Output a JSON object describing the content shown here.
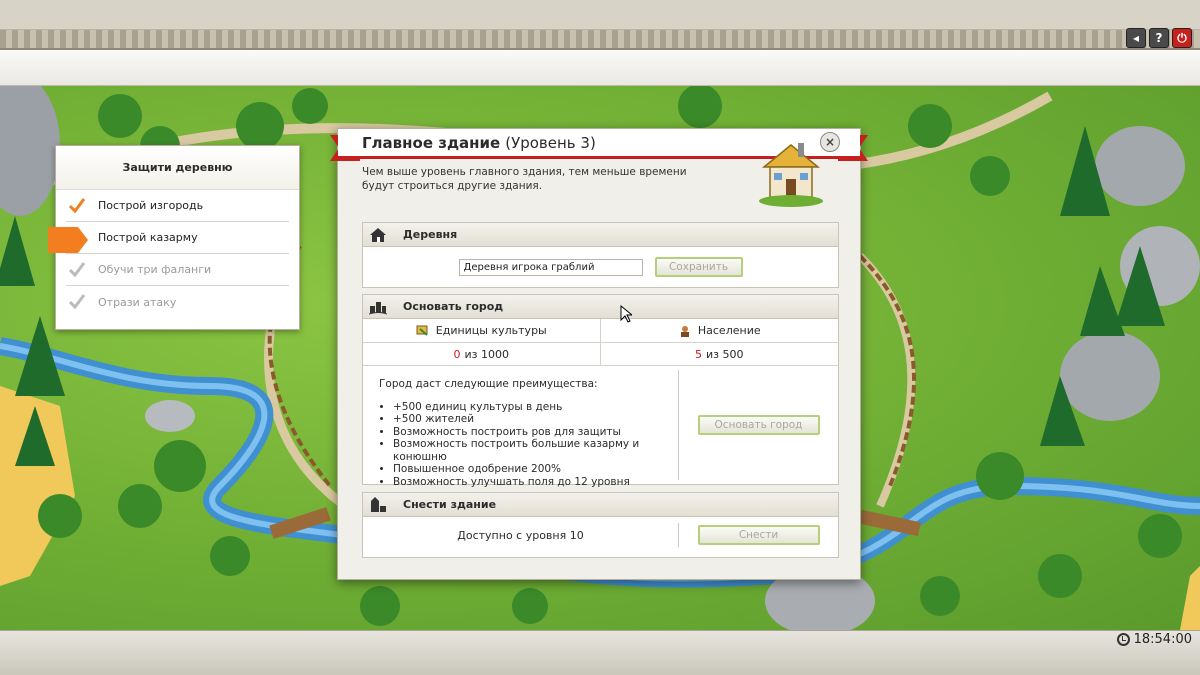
{
  "clock": {
    "time": "18:54:00"
  },
  "top_buttons": {
    "sound": "◂",
    "help": "?",
    "power": "⏻"
  },
  "quest": {
    "title": "Защити деревню",
    "items": [
      {
        "label": "Построй изгородь",
        "state": "done"
      },
      {
        "label": "Построй казарму",
        "state": "current"
      },
      {
        "label": "Обучи три фаланги",
        "state": "future"
      },
      {
        "label": "Отрази атаку",
        "state": "future"
      }
    ]
  },
  "dialog": {
    "title_bold": "Главное здание",
    "title_level": "(Уровень 3)",
    "close": "×",
    "description": "Чем выше уровень главного здания, тем меньше времени будут строиться другие здания.",
    "village": {
      "header": "Деревня",
      "name_value": "Деревня игрока граблий",
      "save_label": "Сохранить"
    },
    "found_city": {
      "header": "Основать город",
      "culture_label": "Единицы культуры",
      "population_label": "Население",
      "culture_current": "0",
      "culture_rest": "из 1000",
      "population_current": "5",
      "population_rest": "из 500",
      "benefits_intro": "Город даст следующие преимущества:",
      "benefits": [
        "+500 единиц культуры в день",
        "+500 жителей",
        "Возможность построить ров для защиты",
        "Возможность построить большие казарму и конюшню",
        "Повышенное одобрение 200%",
        "Возможность улучшать поля до 12 уровня"
      ],
      "button_label": "Основать город"
    },
    "demolish": {
      "header": "Снести здание",
      "availability": "Доступно с уровня 10",
      "button_label": "Снести"
    }
  },
  "colors": {
    "accent_red": "#c51f1f",
    "quest_orange": "#f27e1f",
    "button_border": "#b5d07a"
  }
}
